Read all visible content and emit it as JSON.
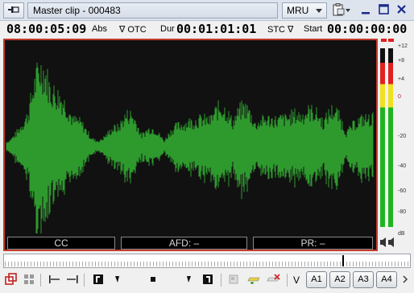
{
  "window": {
    "title": "Master clip - 000483",
    "mru_label": "MRU"
  },
  "timecodes": {
    "position": "08:00:05:09",
    "position_label": "Abs",
    "otc_label": "∇ OTC",
    "duration_label": "Dur",
    "duration": "00:01:01:01",
    "stc_label": "STC ∇",
    "start_label": "Start",
    "start": "00:00:00:00"
  },
  "viewer": {
    "cc_label": "CC",
    "afd_label": "AFD: –",
    "pr_label": "PR: –",
    "waveform_color": "#2e9a2e",
    "border_color": "#c23a2c"
  },
  "meter": {
    "scale_labels": [
      "+12",
      "+8",
      "+4",
      "0",
      "-20",
      "-40",
      "-60",
      "-80",
      "dB"
    ],
    "colors": {
      "green": "#1fb41f",
      "yellow": "#f0e020",
      "red": "#e02020"
    }
  },
  "audio_buttons": [
    "A1",
    "A2",
    "A3",
    "A4"
  ],
  "video_toggle_label": "V"
}
